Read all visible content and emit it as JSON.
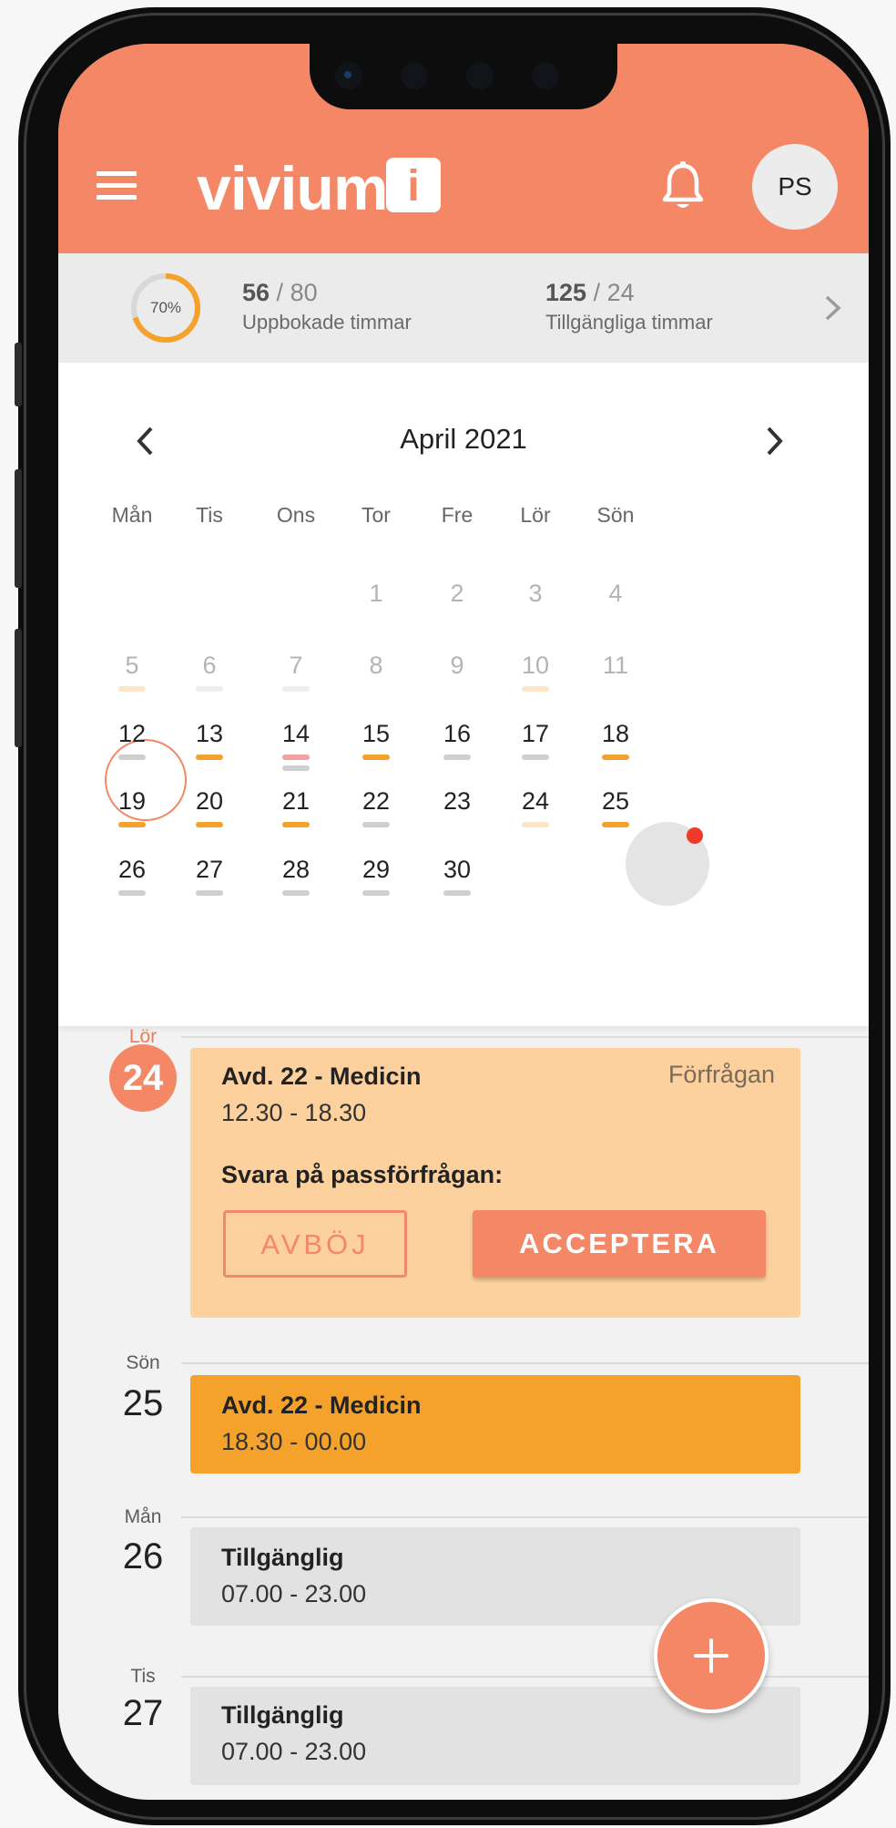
{
  "header": {
    "logo_text": "vivium",
    "logo_mark": "i",
    "avatar_initials": "PS",
    "brand_color": "#f48766"
  },
  "stats": {
    "progress_label": "70%",
    "progress_fraction": 0.7,
    "booked_value": "56",
    "booked_total": "80",
    "booked_label": "Uppbokade timmar",
    "available_value": "125",
    "available_total": "24",
    "available_label": "Tillgängliga timmar"
  },
  "calendar": {
    "month_title": "April 2021",
    "weekdays": [
      "Mån",
      "Tis",
      "Ons",
      "Tor",
      "Fre",
      "Lör",
      "Sön"
    ],
    "weeks": [
      [
        "",
        "",
        "",
        "1",
        "2",
        "3",
        "4"
      ],
      [
        "5",
        "6",
        "7",
        "8",
        "9",
        "10",
        "11"
      ],
      [
        "12",
        "13",
        "14",
        "15",
        "16",
        "17",
        "18"
      ],
      [
        "19",
        "20",
        "21",
        "22",
        "23",
        "24",
        "25"
      ],
      [
        "26",
        "27",
        "28",
        "29",
        "30",
        "",
        ""
      ]
    ],
    "today": "12",
    "selected": "24"
  },
  "agenda": {
    "day1": {
      "weekday": "Lör",
      "date": "24",
      "title": "Avd. 22 - Medicin",
      "time": "12.30 - 18.30",
      "status": "Förfrågan",
      "prompt": "Svara på passförfrågan:",
      "decline_label": "AVBÖJ",
      "accept_label": "ACCEPTERA"
    },
    "day2": {
      "weekday": "Sön",
      "date": "25",
      "title": "Avd. 22 - Medicin",
      "time": "18.30 - 00.00"
    },
    "day3": {
      "weekday": "Mån",
      "date": "26",
      "title": "Tillgänglig",
      "time": "07.00 - 23.00"
    },
    "day4": {
      "weekday": "Tis",
      "date": "27",
      "title": "Tillgänglig",
      "time": "07.00 - 23.00"
    }
  },
  "fab": {
    "icon": "plus-icon"
  }
}
